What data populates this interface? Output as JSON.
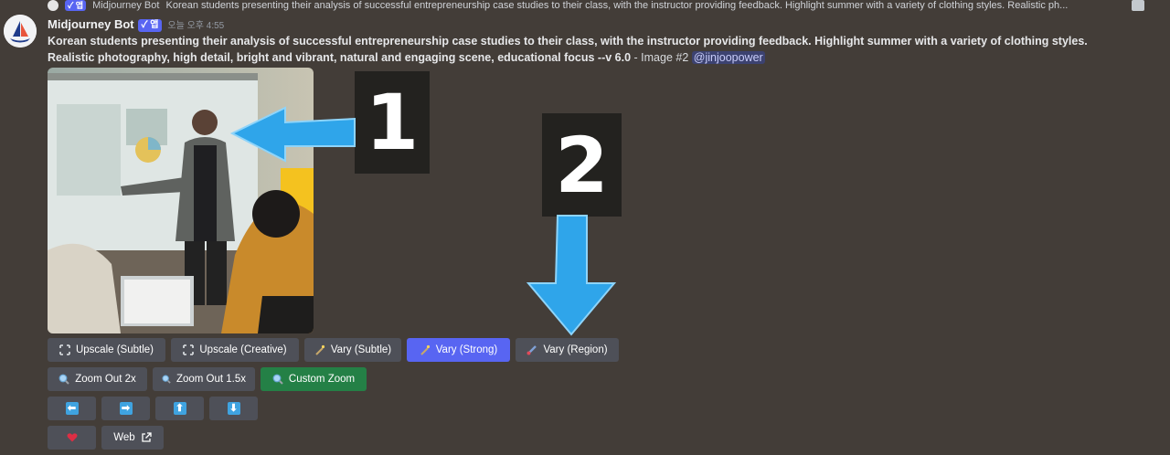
{
  "reply": {
    "author": "Midjourney Bot",
    "badge": "✓ 앱",
    "snippet": "Korean students presenting their analysis of successful entrepreneurship case studies to their class, with the instructor providing feedback. Highlight summer with a variety of clothing styles. Realistic ph..."
  },
  "message": {
    "author": "Midjourney Bot",
    "badge": "✓ 앱",
    "timestamp": "오늘 오후 4:55",
    "prompt": "Korean students presenting their analysis of successful entrepreneurship case studies to their class, with the instructor providing feedback. Highlight summer with a variety of clothing styles. Realistic photography, high detail, bright and vibrant, natural and engaging scene, educational focus --v 6.0",
    "suffix": " - Image #2 ",
    "mention": "@jinjoopower"
  },
  "callouts": {
    "one": "1",
    "two": "2"
  },
  "buttons": {
    "upscale_subtle": "Upscale (Subtle)",
    "upscale_creative": "Upscale (Creative)",
    "vary_subtle": "Vary (Subtle)",
    "vary_strong": "Vary (Strong)",
    "vary_region": "Vary (Region)",
    "zoom_out_2x": "Zoom Out 2x",
    "zoom_out_1_5x": "Zoom Out 1.5x",
    "custom_zoom": "Custom Zoom",
    "web": "Web"
  },
  "colors": {
    "background": "#433d38",
    "button": "#4e5058",
    "primary": "#5865f2",
    "success": "#248046",
    "arrow": "#3fa3e0"
  }
}
